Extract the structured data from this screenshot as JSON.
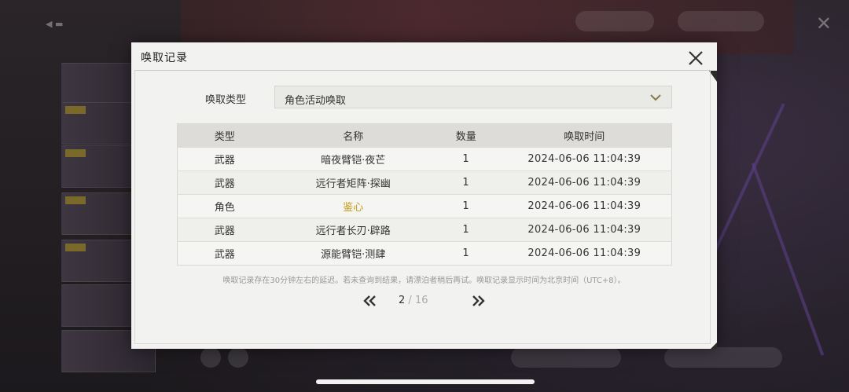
{
  "dialog": {
    "title": "唤取记录",
    "close_icon": "close-x-icon"
  },
  "filter": {
    "label": "唤取类型",
    "selected": "角色活动唤取",
    "chevron_icon": "chevron-down-icon"
  },
  "table": {
    "headers": [
      "类型",
      "名称",
      "数量",
      "唤取时间"
    ],
    "rows": [
      {
        "type": "武器",
        "name": "暗夜臂铠·夜芒",
        "qty": "1",
        "time": "2024-06-06 11:04:39"
      },
      {
        "type": "武器",
        "name": "远行者矩阵·探幽",
        "qty": "1",
        "time": "2024-06-06 11:04:39"
      },
      {
        "type": "角色",
        "name": "鉴心",
        "qty": "1",
        "time": "2024-06-06 11:04:39"
      },
      {
        "type": "武器",
        "name": "远行者长刃·辟路",
        "qty": "1",
        "time": "2024-06-06 11:04:39"
      },
      {
        "type": "武器",
        "name": "源能臂铠·测肆",
        "qty": "1",
        "time": "2024-06-06 11:04:39"
      }
    ],
    "highlight_color": "#c69a1c"
  },
  "note": "唤取记录存在30分钟左右的延迟。若未查询到结果，请漂泊者稍后再试。唤取记录显示时间为北京时间（UTC+8）。",
  "pager": {
    "current": "2",
    "separator": " / ",
    "total": "16",
    "prev_icon": "double-chevron-left-icon",
    "next_icon": "double-chevron-right-icon"
  }
}
